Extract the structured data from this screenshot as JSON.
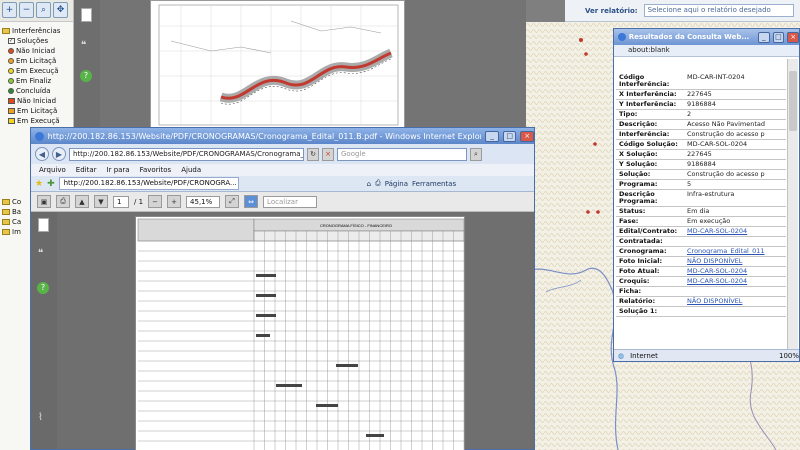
{
  "left_panel": {
    "layers": [
      {
        "label": "Interferências",
        "marker": "folder"
      },
      {
        "label": "Soluções",
        "marker": "check"
      },
      {
        "label": "Não Iniciad",
        "marker": "dot",
        "color": "#e04a1f"
      },
      {
        "label": "Em Licitaçã",
        "marker": "dot",
        "color": "#f0a020"
      },
      {
        "label": "Em Execuçã",
        "marker": "dot",
        "color": "#f4d41f"
      },
      {
        "label": "Em Finaliz",
        "marker": "dot",
        "color": "#8fc83a"
      },
      {
        "label": "Concluída",
        "marker": "dot",
        "color": "#2f8a2f"
      },
      {
        "label": "Não Iniciad",
        "marker": "square",
        "color": "#e04a1f"
      },
      {
        "label": "Em Licitaçã",
        "marker": "square",
        "color": "#f0a020"
      },
      {
        "label": "Em Execuçã",
        "marker": "square",
        "color": "#f4d41f"
      }
    ],
    "folders": [
      "Co",
      "Ba",
      "Ca",
      "Im"
    ]
  },
  "right_header": {
    "label": "Ver relatório:",
    "select_placeholder": "Selecione aqui o relatório desejado"
  },
  "ie_window": {
    "title": "http://200.182.86.153/Website/PDF/CRONOGRAMAS/Cronograma_Edital_011.B.pdf - Windows Internet Explorer",
    "url": "http://200.182.86.153/Website/PDF/CRONOGRAMAS/Cronograma_Edital_0",
    "search_placeholder": "Google",
    "menu": [
      "Arquivo",
      "Editar",
      "Ir para",
      "Favoritos",
      "Ajuda"
    ],
    "tab_label": "http://200.182.86.153/Website/PDF/CRONOGRA...",
    "tab_tools": [
      "Página",
      "Ferramentas"
    ],
    "pdf_page": "1",
    "pdf_pages_total": "/ 1",
    "pdf_zoom": "45,1%",
    "pdf_find_placeholder": "Localizar",
    "doc_title": "CRONOGRAMA FÍSICO - FINANCEIRO"
  },
  "popup": {
    "title": "Resultados da Consulta Web...",
    "address": "about:blank",
    "status": "Internet",
    "zoom": "100%",
    "rows": [
      {
        "k": "Código Interferência:",
        "v": "MD-CAR-INT-0204",
        "link": false
      },
      {
        "k": "X Interferência:",
        "v": "227645",
        "link": false
      },
      {
        "k": "Y Interferência:",
        "v": "9186884",
        "link": false
      },
      {
        "k": "Tipo:",
        "v": "2",
        "link": false
      },
      {
        "k": "Descrição:",
        "v": "Acesso Não Pavimentad",
        "link": false
      },
      {
        "k": "Interferência:",
        "v": "Construção do acesso p",
        "link": false
      },
      {
        "k": "Código Solução:",
        "v": "MD-CAR-SOL-0204",
        "link": false
      },
      {
        "k": "X Solução:",
        "v": "227645",
        "link": false
      },
      {
        "k": "Y Solução:",
        "v": "9186884",
        "link": false
      },
      {
        "k": "Solução:",
        "v": "Construção do acesso p",
        "link": false
      },
      {
        "k": "Programa:",
        "v": "5",
        "link": false
      },
      {
        "k": "Descrição Programa:",
        "v": "Infra-estrutura",
        "link": false
      },
      {
        "k": "Status:",
        "v": "Em dia",
        "link": false
      },
      {
        "k": "Fase:",
        "v": "Em execução",
        "link": false
      },
      {
        "k": "Edital/Contrato:",
        "v": "MD-CAR-SOL-0204",
        "link": true
      },
      {
        "k": "Contratada:",
        "v": "",
        "link": false
      },
      {
        "k": "Cronograma:",
        "v": "Cronograma_Edital_011",
        "link": true
      },
      {
        "k": "Foto Inicial:",
        "v": "NÃO DISPONÍVEL",
        "link": true
      },
      {
        "k": "Foto Atual:",
        "v": "MD-CAR-SOL-0204",
        "link": true
      },
      {
        "k": "Croquis:",
        "v": "MD-CAR-SOL-0204",
        "link": true
      },
      {
        "k": "Ficha:",
        "v": "",
        "link": false
      },
      {
        "k": "Relatório:",
        "v": "NÃO DISPONÍVEL",
        "link": true
      },
      {
        "k": "Solução 1:",
        "v": "",
        "link": false
      }
    ]
  }
}
